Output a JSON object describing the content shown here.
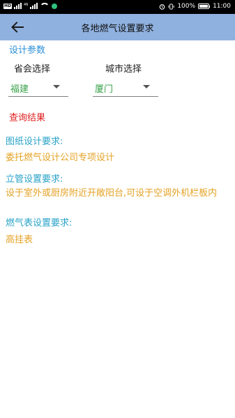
{
  "status_bar": {
    "left_chips": [
      "HD",
      "46"
    ],
    "battery": "100%",
    "time": "11:00",
    "icons": [
      "signal-icon",
      "wifi-icon",
      "app-dot-icon",
      "alarm-icon",
      "vibrate-icon",
      "battery-icon"
    ]
  },
  "toolbar": {
    "back_icon": "arrow-left-icon",
    "title": "各地燃气设置要求",
    "background": "#8fb1e0"
  },
  "design_params": {
    "label": "设计参数",
    "province": {
      "label": "省会选择",
      "selected": "福建"
    },
    "city": {
      "label": "城市选择",
      "selected": "厦门"
    }
  },
  "results": {
    "title": "查询结果",
    "items": [
      {
        "label": "图纸设计要求:",
        "value": "委托燃气设计公司专项设计"
      },
      {
        "label": "立管设置要求:",
        "value": "设于室外或厨房附近开敞阳台,可设于空调外机栏板内"
      },
      {
        "label": "燃气表设置要求:",
        "value": "高挂表"
      }
    ]
  },
  "colors": {
    "section": "#2a8fd8",
    "selected_value": "#3aa24a",
    "result_title": "#e01f1f",
    "req_label": "#2aa3c8",
    "req_value": "#e4a224"
  }
}
